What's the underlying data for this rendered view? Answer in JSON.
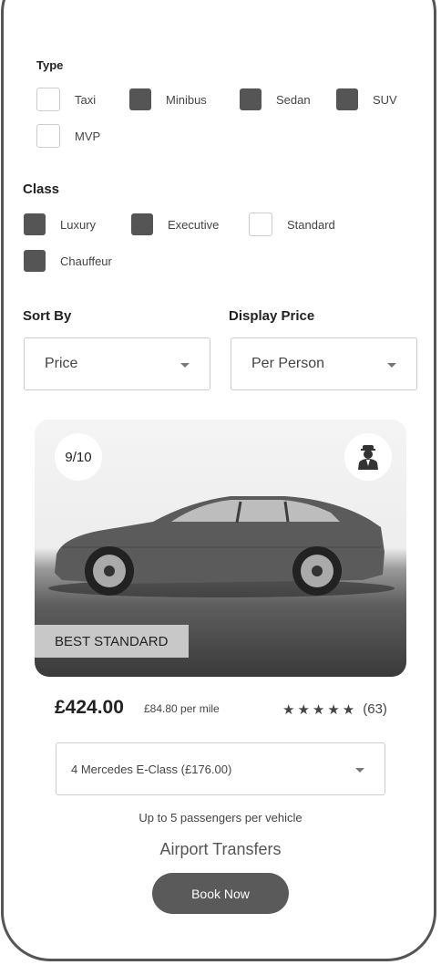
{
  "filters": {
    "type": {
      "title": "Type",
      "options": [
        {
          "label": "Taxi",
          "checked": false
        },
        {
          "label": "Minibus",
          "checked": true
        },
        {
          "label": "Sedan",
          "checked": true
        },
        {
          "label": "SUV",
          "checked": true
        },
        {
          "label": "MVP",
          "checked": false
        }
      ]
    },
    "class": {
      "title": "Class",
      "options": [
        {
          "label": "Luxury",
          "checked": true
        },
        {
          "label": "Executive",
          "checked": true
        },
        {
          "label": "Standard",
          "checked": false
        },
        {
          "label": "Chauffeur",
          "checked": true
        }
      ]
    }
  },
  "sort": {
    "title": "Sort By",
    "value": "Price"
  },
  "display_price": {
    "title": "Display Price",
    "value": "Per Person"
  },
  "card": {
    "score": "9/10",
    "badge": "BEST STANDARD",
    "driver_icon": "chauffeur-icon",
    "price": "£424.00",
    "per_mile": "£84.80 per mile",
    "stars": "★★★★★",
    "star_count": 5,
    "reviews": "(63)",
    "vehicle_option": "4 Mercedes E-Class  (£176.00)",
    "passengers": "Up to 5 passengers per vehicle",
    "service": "Airport Transfers",
    "book_label": "Book Now"
  },
  "colors": {
    "checked": "#555555",
    "button": "#5a5a5a",
    "border": "#cccccc"
  }
}
